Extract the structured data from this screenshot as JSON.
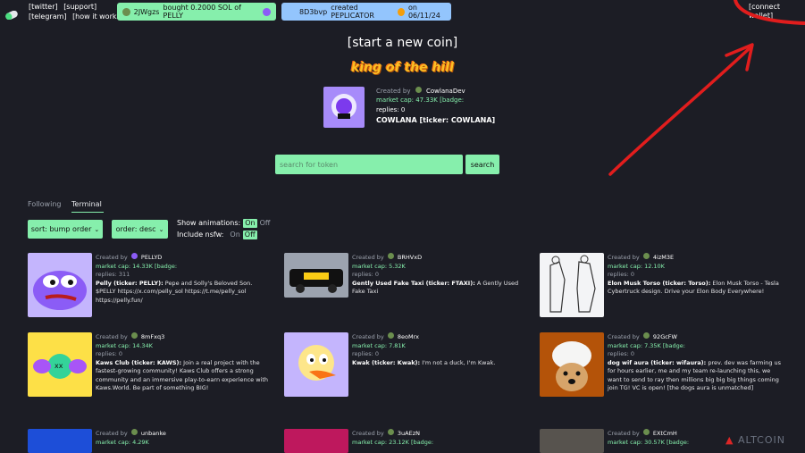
{
  "topbar": {
    "links": [
      "[twitter]",
      "[support]",
      "[telegram]",
      "[how it works]"
    ],
    "activity_buy": {
      "user": "2JWgzs",
      "text": "bought 0.2000 SOL of PELLY"
    },
    "activity_create": {
      "user": "8D3bvp",
      "text": "created PEPLICATOR",
      "date": "on 06/11/24"
    },
    "connect_wallet": "[connect wallet]"
  },
  "start_coin": "[start a new coin]",
  "king_of_hill": {
    "banner": "king of the hill",
    "created_by_label": "Created by",
    "creator": "CowlanaDev",
    "market_cap": "market cap: 47.33K",
    "badge": "[badge:",
    "replies": "replies: 0",
    "name": "COWLANA [ticker: COWLANA]"
  },
  "search": {
    "placeholder": "search for token",
    "button": "search"
  },
  "tabs": [
    "Following",
    "Terminal"
  ],
  "controls": {
    "sort": "sort: bump order",
    "order": "order: desc",
    "show_animations_label": "Show animations:",
    "include_nsfw_label": "Include nsfw:",
    "on": "On",
    "off": "Off"
  },
  "cards": [
    {
      "created": "Created by",
      "creator": "PELLYD",
      "mcap": "market cap: 14.33K",
      "badge": "[badge:",
      "replies": "replies: 311",
      "title": "Pelly (ticker: PELLY):",
      "desc": "Pepe and Solly's Beloved Son. $PELLY https://x.com/pelly_sol https://t.me/pelly_sol https://pelly.fun/"
    },
    {
      "created": "Created by",
      "creator": "BRHVxD",
      "mcap": "market cap: 5.32K",
      "badge": "",
      "replies": "replies: 0",
      "title": "Gently Used Fake Taxi (ticker: FTAXI):",
      "desc": "A Gently Used Fake Taxi"
    },
    {
      "created": "Created by",
      "creator": "4izM3E",
      "mcap": "market cap: 12.10K",
      "badge": "",
      "replies": "replies: 0",
      "title": "Elon Musk Torso (ticker: Torso):",
      "desc": "Elon Musk Torso - Tesla Cybertruck design. Drive your Elon Body Everywhere!"
    },
    {
      "created": "Created by",
      "creator": "8mFxq3",
      "mcap": "market cap: 14.34K",
      "badge": "",
      "replies": "replies: 0",
      "title": "Kaws Club (ticker: KAWS):",
      "desc": "Join a real project with the fastest-growing community! Kaws Club offers a strong community and an immersive play-to-earn experience with Kaws.World. Be part of something BIG!"
    },
    {
      "created": "Created by",
      "creator": "8eoMrx",
      "mcap": "market cap: 7.81K",
      "badge": "",
      "replies": "replies: 0",
      "title": "Kwak (ticker: Kwak):",
      "desc": "I'm not a duck, I'm Kwak."
    },
    {
      "created": "Created by",
      "creator": "92GcFW",
      "mcap": "market cap: 7.35K",
      "badge": "[badge:",
      "replies": "replies: 0",
      "title": "dog wif aura (ticker: wifaura):",
      "desc": "prev. dev was farming us for hours earlier, me and my team re-launching this, we want to send to ray then millions big big big things coming join TG! VC is open! [the dogs aura is unmatched]"
    },
    {
      "created": "Created by",
      "creator": "unbanke",
      "mcap": "market cap: 4.29K",
      "badge": "",
      "replies": "",
      "title": "",
      "desc": ""
    },
    {
      "created": "Created by",
      "creator": "3uAEzN",
      "mcap": "market cap: 23.12K",
      "badge": "[badge:",
      "replies": "",
      "title": "",
      "desc": ""
    },
    {
      "created": "Created by",
      "creator": "EXtCmH",
      "mcap": "market cap: 30.57K",
      "badge": "[badge:",
      "replies": "",
      "title": "",
      "desc": ""
    }
  ],
  "watermark": "ALTCOIN",
  "colors": {
    "accent_green": "#86efac",
    "buy_pill": "#86efac",
    "create_pill": "#93c5fd",
    "annotation_red": "#e11d1d",
    "background": "#1c1d25"
  }
}
